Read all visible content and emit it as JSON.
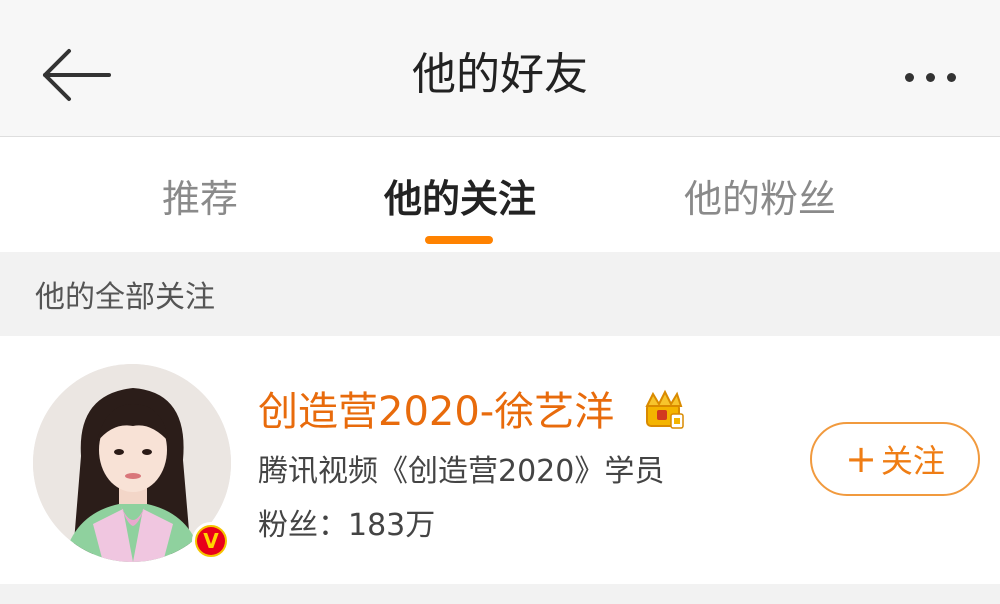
{
  "navbar": {
    "title": "他的好友",
    "back_icon": "arrow-left-icon",
    "more_icon": "more-dots-icon"
  },
  "tabs": [
    {
      "label": "推荐",
      "active": false
    },
    {
      "label": "他的关注",
      "active": true
    },
    {
      "label": "他的粉丝",
      "active": false
    }
  ],
  "section": {
    "title": "他的全部关注"
  },
  "user": {
    "name": "创造营2020-徐艺洋",
    "description": "腾讯视频《创造营2020》学员",
    "fans": "粉丝：183万",
    "follow_plus": "+",
    "follow_label": "关注",
    "verified_mark": "V",
    "crown_icon": "crown-icon"
  },
  "colors": {
    "accent": "#ff8200",
    "name": "#e86b0c",
    "follow_border": "#f19a3e"
  }
}
